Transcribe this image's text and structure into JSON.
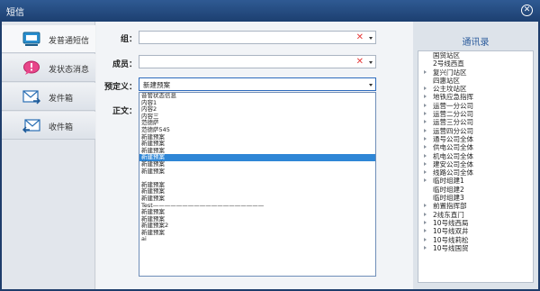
{
  "window": {
    "title": "短信"
  },
  "sidebar": {
    "items": [
      {
        "label": "发普通短信",
        "icon": "chat-bubble-icon"
      },
      {
        "label": "发状态消息",
        "icon": "alert-bubble-icon"
      },
      {
        "label": "发件箱",
        "icon": "outbox-mail-icon"
      },
      {
        "label": "收件箱",
        "icon": "inbox-mail-icon"
      }
    ]
  },
  "form": {
    "group_label": "组：",
    "group_value": "",
    "member_label": "成员：",
    "member_value": "",
    "preset_label": "预定义：",
    "preset_value": "新建预案",
    "body_label": "正文："
  },
  "preset_options": [
    "音管状态信息",
    "内容1",
    "内容2",
    "内容三",
    "范德萨",
    "范德萨545",
    "新建预案",
    "新建预案",
    "新建预案",
    "新建预案",
    "新建预案",
    "新建预案",
    "",
    "新建预案",
    "新建预案",
    "新建预案",
    "Test———————————————————",
    "新建预案",
    "新建预案",
    "新建预案2",
    "新建预案",
    "ai"
  ],
  "selected_index": 9,
  "contacts": {
    "title": "通讯录",
    "items": [
      {
        "label": "国贸站区",
        "arrow": false
      },
      {
        "label": "2号线西直",
        "arrow": false
      },
      {
        "label": "复兴门站区",
        "arrow": true
      },
      {
        "label": "四惠站区",
        "arrow": false
      },
      {
        "label": "公主坟站区",
        "arrow": true
      },
      {
        "label": "地铁应急指挥",
        "arrow": true
      },
      {
        "label": "运营一分公司",
        "arrow": true
      },
      {
        "label": "运营二分公司",
        "arrow": true
      },
      {
        "label": "运营三分公司",
        "arrow": true
      },
      {
        "label": "运营四分公司",
        "arrow": true
      },
      {
        "label": "通号公司全体",
        "arrow": true
      },
      {
        "label": "供电公司全体",
        "arrow": true
      },
      {
        "label": "机电公司全体",
        "arrow": true
      },
      {
        "label": "建安公司全体",
        "arrow": true
      },
      {
        "label": "线路公司全体",
        "arrow": true
      },
      {
        "label": "临时组建1",
        "arrow": true
      },
      {
        "label": "临时组建2",
        "arrow": false
      },
      {
        "label": "临时组建3",
        "arrow": false
      },
      {
        "label": "前置指挥部",
        "arrow": true
      },
      {
        "label": "2线东直门",
        "arrow": true
      },
      {
        "label": "10号线西局",
        "arrow": true
      },
      {
        "label": "10号线双井",
        "arrow": true
      },
      {
        "label": "10号线莉松",
        "arrow": true
      },
      {
        "label": "10号线国贸",
        "arrow": true
      }
    ]
  },
  "colors": {
    "title_bar": "#1c3f70",
    "accent": "#2e86d6",
    "clear": "#e53b3b"
  }
}
